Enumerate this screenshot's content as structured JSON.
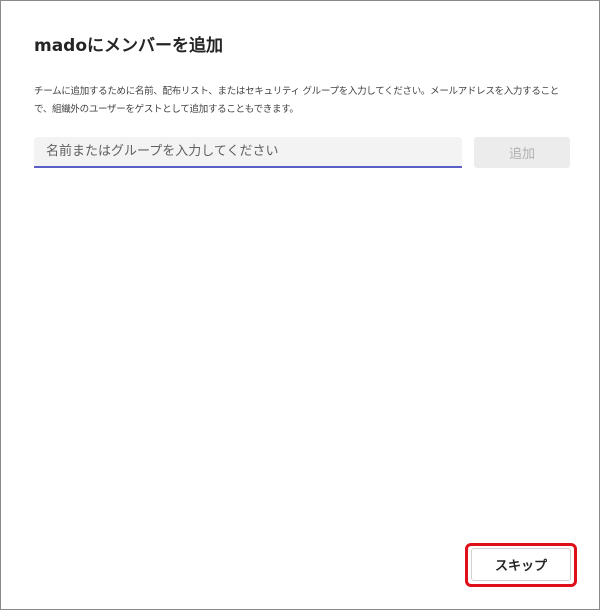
{
  "dialog": {
    "title": "madoにメンバーを追加",
    "description": "チームに追加するために名前、配布リスト、またはセキュリティ グループを入力してください。メールアドレスを入力することで、組織外のユーザーをゲストとして追加することもできます。",
    "search": {
      "placeholder": "名前またはグループを入力してください",
      "value": ""
    },
    "add_label": "追加",
    "skip_label": "スキップ"
  },
  "colors": {
    "accent": "#5b5fc7",
    "highlight": "#e0101a",
    "disabled_bg": "#ececec",
    "disabled_text": "#b0b0b0"
  }
}
